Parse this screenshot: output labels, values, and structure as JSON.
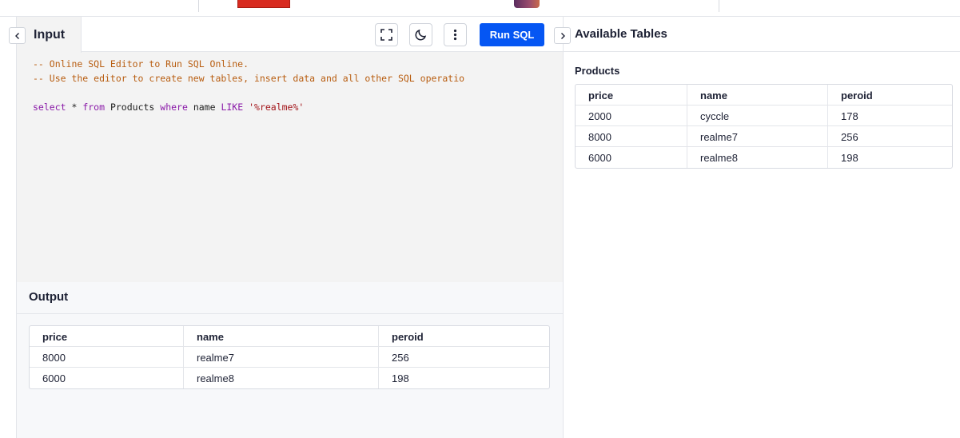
{
  "input": {
    "tab_label": "Input",
    "run_label": "Run SQL",
    "code": {
      "line1": "-- Online SQL Editor to Run SQL Online.",
      "line2": "-- Use the editor to create new tables, insert data and all other SQL operatio",
      "q_select": "select",
      "q_star": " * ",
      "q_from": "from",
      "q_table": " Products ",
      "q_where": "where",
      "q_name": " name ",
      "q_like": "LIKE",
      "q_string": "'%realme%'"
    }
  },
  "output": {
    "title": "Output",
    "columns": [
      "price",
      "name",
      "peroid"
    ],
    "rows": [
      [
        "8000",
        "realme7",
        "256"
      ],
      [
        "6000",
        "realme8",
        "198"
      ]
    ]
  },
  "tables_panel": {
    "title": "Available Tables",
    "table_name": "Products",
    "columns": [
      "price",
      "name",
      "peroid"
    ],
    "rows": [
      [
        "2000",
        "cyccle",
        "178"
      ],
      [
        "8000",
        "realme7",
        "256"
      ],
      [
        "6000",
        "realme8",
        "198"
      ]
    ]
  },
  "icons": {
    "collapse_left": "chevron-left-icon",
    "collapse_right": "chevron-right-icon",
    "fullscreen": "fullscreen-icon",
    "theme": "moon-icon",
    "more": "more-vertical-icon"
  },
  "colors": {
    "accent": "#0556f3",
    "comment": "#b85d10",
    "keyword": "#8a1aa8",
    "string": "#a3151a"
  }
}
